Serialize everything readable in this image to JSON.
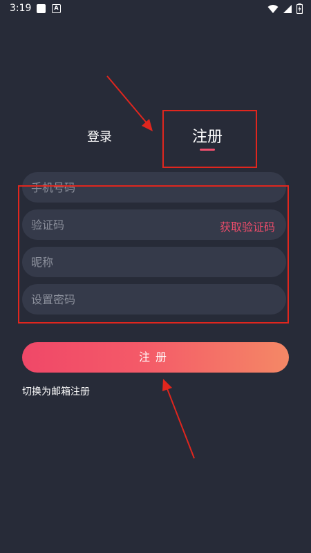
{
  "status_bar": {
    "time": "3:19",
    "a_icon_glyph": "A",
    "icons": [
      "app-icon",
      "a-icon",
      "wifi-icon",
      "signal-icon",
      "battery-icon"
    ]
  },
  "tabs": {
    "login_label": "登录",
    "register_label": "注册",
    "active": "register"
  },
  "form": {
    "phone_placeholder": "手机号码",
    "code_placeholder": "验证码",
    "get_code_label": "获取验证码",
    "nickname_placeholder": "昵称",
    "password_placeholder": "设置密码"
  },
  "submit_label": "注册",
  "switch_email_label": "切换为邮箱注册",
  "colors": {
    "background": "#272b38",
    "field_bg": "#353a4a",
    "accent": "#ec4c6a",
    "gradient_start": "#f04868",
    "gradient_end": "#f48866",
    "annotation": "#e0261e"
  }
}
